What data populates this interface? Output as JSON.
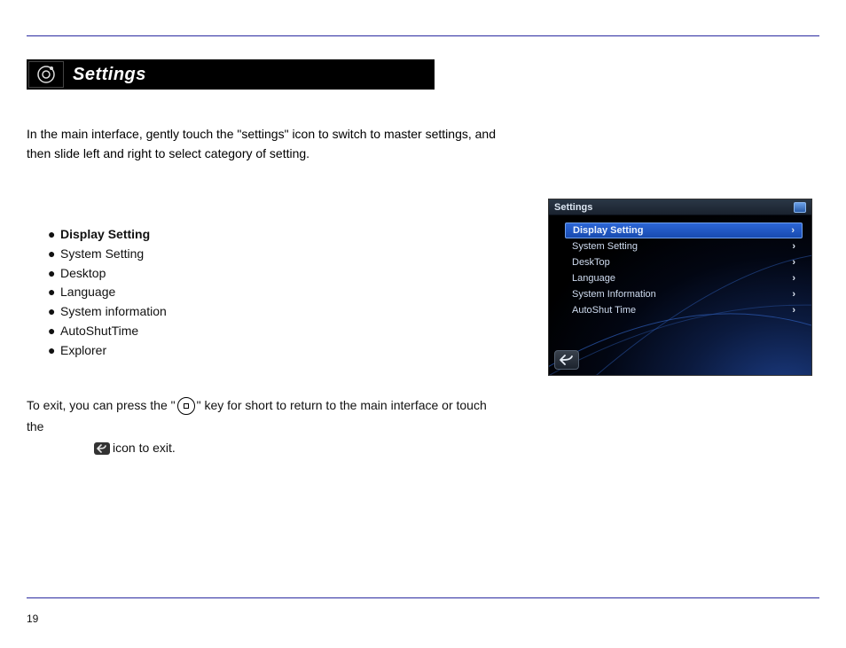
{
  "section": {
    "title": "Settings"
  },
  "intro": {
    "line1": "In the main interface, gently touch the \"settings\" icon to switch to",
    "line2": "master settings, and then slide left and right to select category of setting."
  },
  "bullets": [
    {
      "label": "Display Setting",
      "bold": true
    },
    {
      "label": "System Setting",
      "bold": false
    },
    {
      "label": "Desktop",
      "bold": false
    },
    {
      "label": "Language",
      "bold": false
    },
    {
      "label": "System information",
      "bold": false
    },
    {
      "label": "AutoShutTime",
      "bold": false
    },
    {
      "label": "Explorer",
      "bold": false
    }
  ],
  "exit": {
    "part1": "To exit, you can press the \"",
    "part2": "\" key for short to return to the main interface or touch the",
    "part3": "icon to exit."
  },
  "screenshot": {
    "title": "Settings",
    "items": [
      {
        "label": "Display Setting",
        "selected": true
      },
      {
        "label": "System Setting",
        "selected": false
      },
      {
        "label": "DeskTop",
        "selected": false
      },
      {
        "label": "Language",
        "selected": false
      },
      {
        "label": "System Information",
        "selected": false
      },
      {
        "label": "AutoShut Time",
        "selected": false
      }
    ]
  },
  "page_number": "19"
}
